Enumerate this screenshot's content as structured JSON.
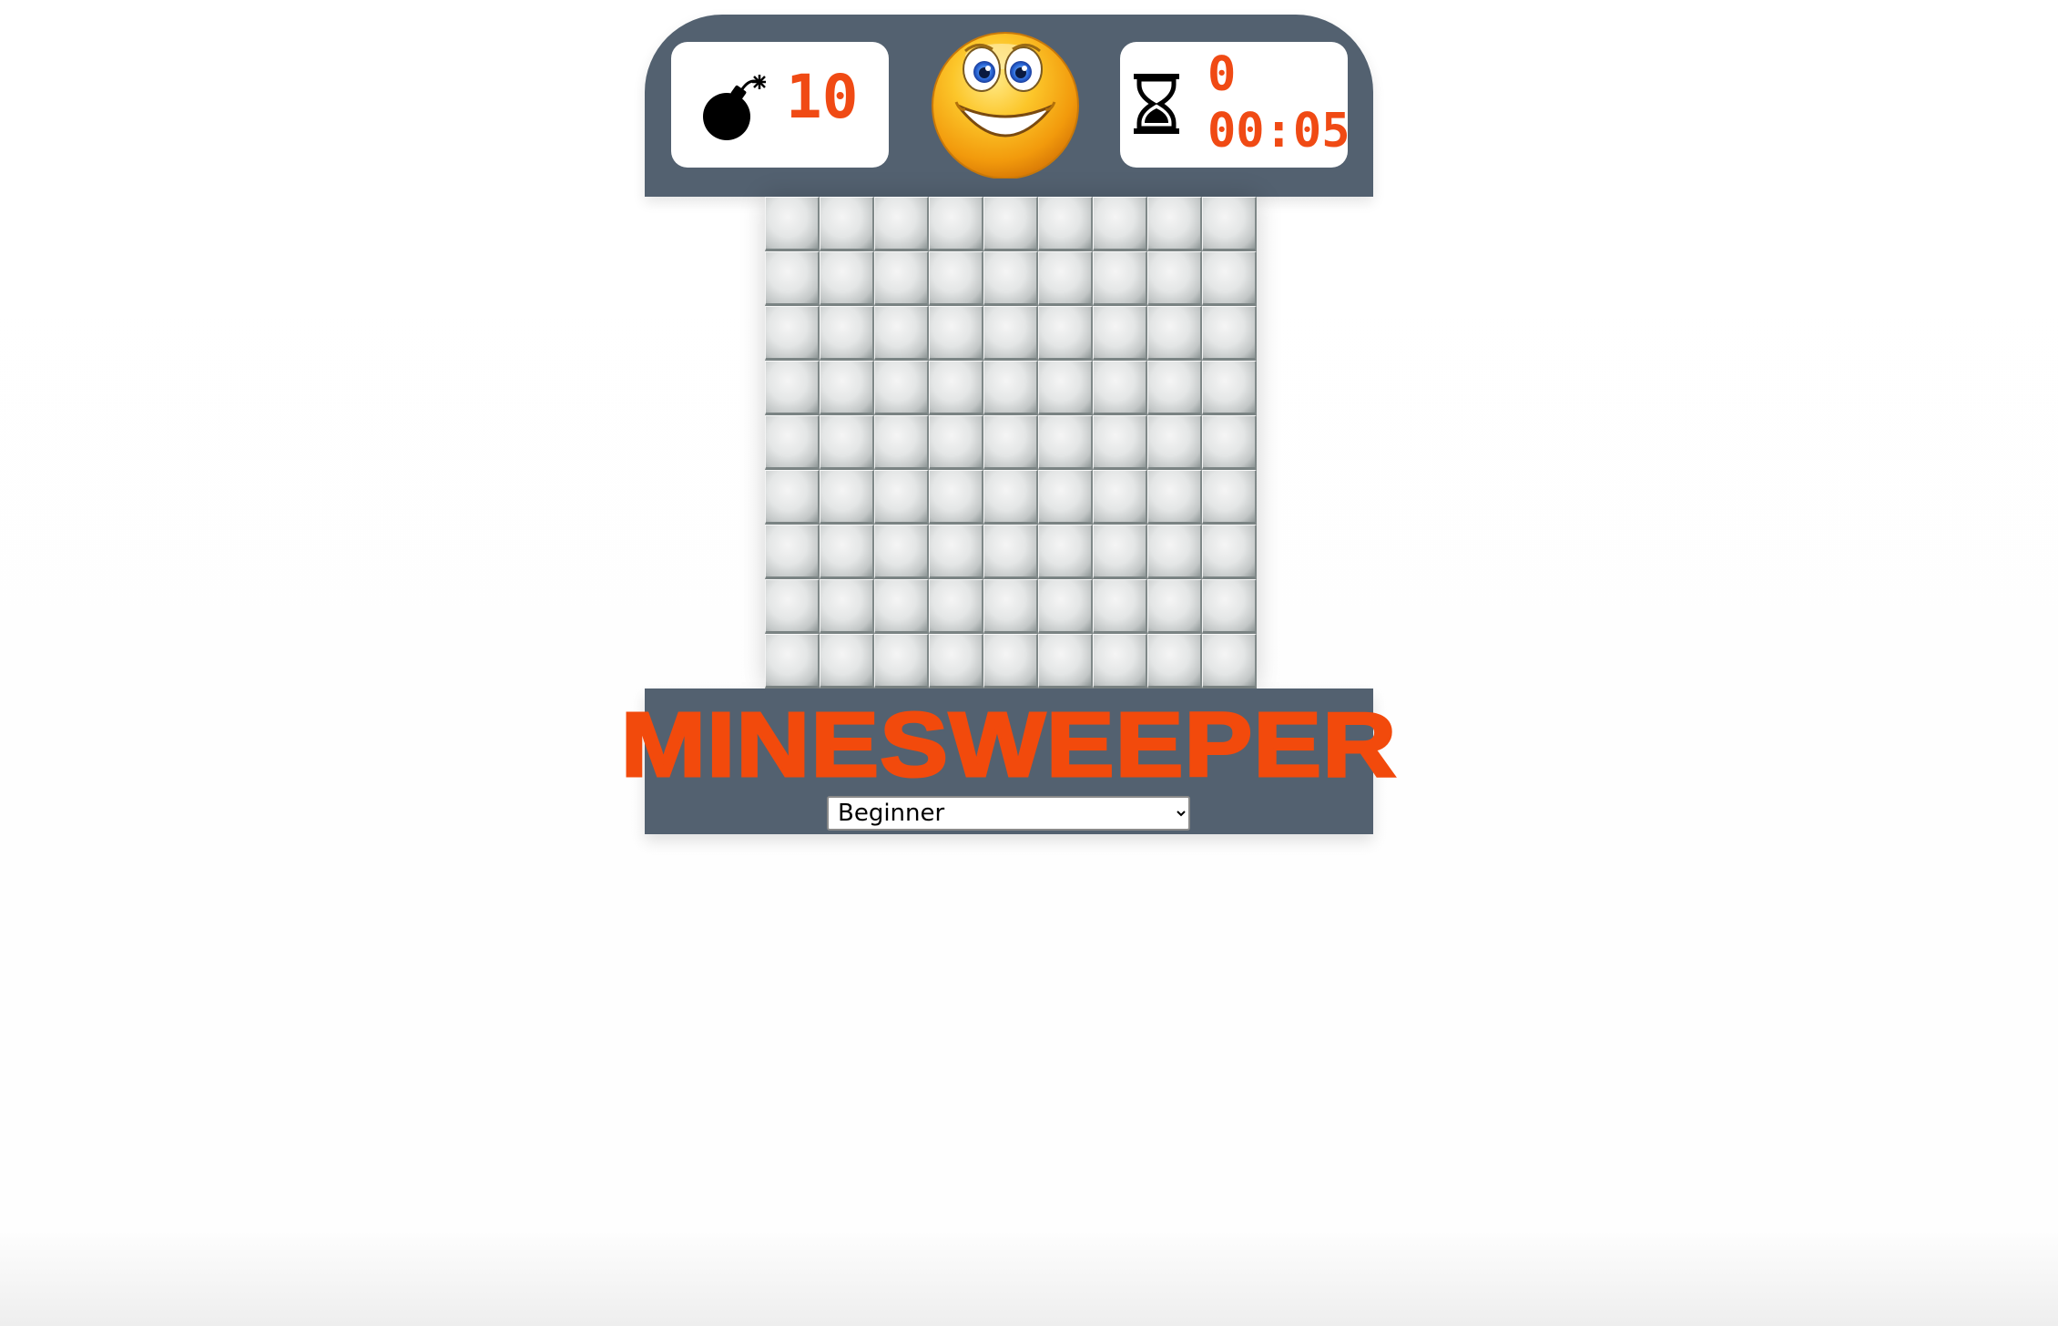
{
  "app": {
    "title": "MINESWEEPER"
  },
  "header": {
    "mine_counter": {
      "icon": "bomb-icon",
      "value": "10"
    },
    "reset_button": {
      "icon": "smiley-face-icon",
      "state": "happy"
    },
    "timer": {
      "icon": "hourglass-icon",
      "seconds": "0",
      "clock": "00:05"
    }
  },
  "board": {
    "rows": 9,
    "columns": 9,
    "cell_state": "covered"
  },
  "footer": {
    "title": "MINESWEEPER",
    "difficulty": {
      "selected": "Beginner",
      "options": [
        "Beginner"
      ]
    }
  },
  "colors": {
    "panel_background": "#536170",
    "accent": "#f04a14",
    "display_background": "#ffffff"
  }
}
